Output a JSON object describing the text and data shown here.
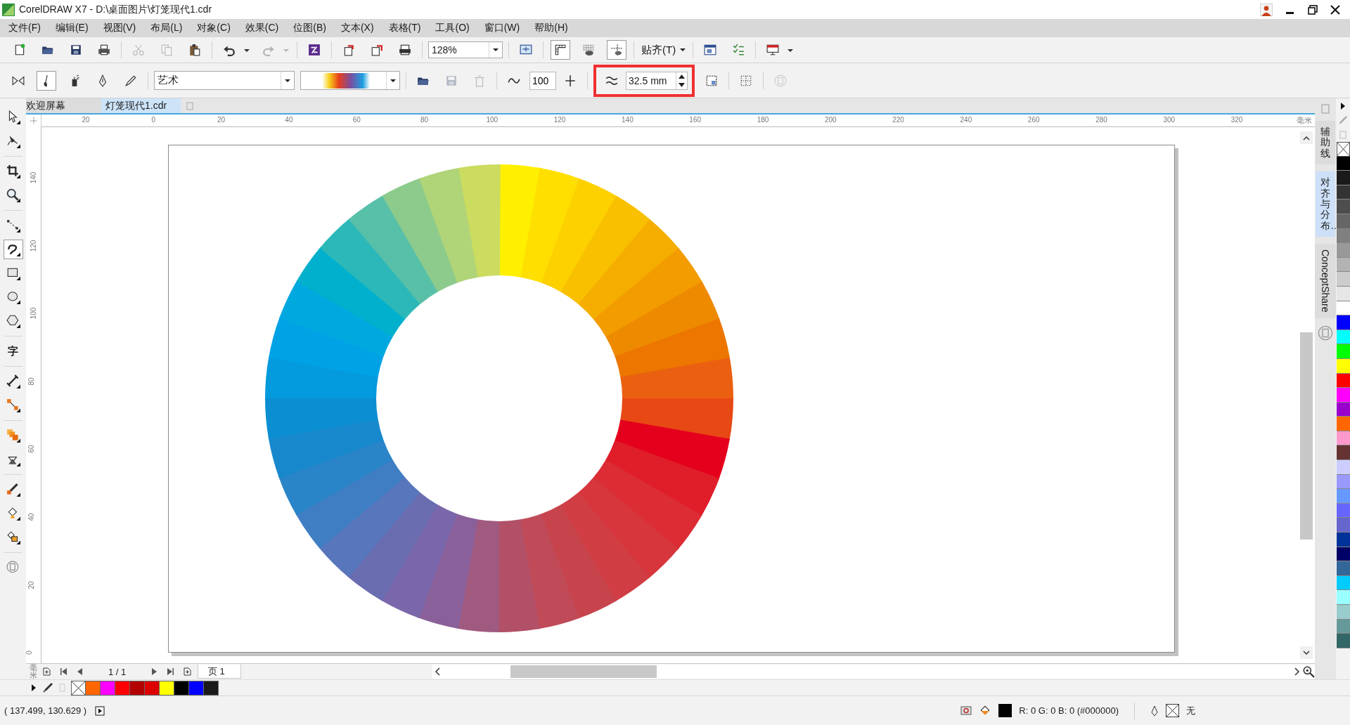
{
  "window": {
    "title": "CorelDRAW X7 - D:\\桌面图片\\灯笼现代1.cdr"
  },
  "menu": [
    "文件(F)",
    "编辑(E)",
    "视图(V)",
    "布局(L)",
    "对象(C)",
    "效果(C)",
    "位图(B)",
    "文本(X)",
    "表格(T)",
    "工具(O)",
    "窗口(W)",
    "帮助(H)"
  ],
  "toolbar": [
    {
      "kind": "new",
      "disabled": false
    },
    {
      "kind": "open",
      "disabled": false
    },
    {
      "kind": "save",
      "disabled": false
    },
    {
      "kind": "print",
      "disabled": false
    },
    {
      "kind": "sep"
    },
    {
      "kind": "cut",
      "disabled": true
    },
    {
      "kind": "copy",
      "disabled": true
    },
    {
      "kind": "paste",
      "disabled": false
    },
    {
      "kind": "sep"
    },
    {
      "kind": "undo",
      "disabled": false
    },
    {
      "kind": "caret",
      "disabled": false
    },
    {
      "kind": "redo",
      "disabled": true
    },
    {
      "kind": "caret",
      "disabled": true
    },
    {
      "kind": "sep"
    },
    {
      "kind": "launcher",
      "disabled": false
    },
    {
      "kind": "sep"
    },
    {
      "kind": "import",
      "disabled": false
    },
    {
      "kind": "export",
      "disabled": false
    },
    {
      "kind": "pdf",
      "disabled": false
    },
    {
      "kind": "sep"
    },
    {
      "kind": "zoom-combo",
      "value": "128%"
    },
    {
      "kind": "sep"
    },
    {
      "kind": "fullscreen",
      "disabled": false
    },
    {
      "kind": "sep"
    },
    {
      "kind": "rulers",
      "disabled": false,
      "selected": true
    },
    {
      "kind": "grid",
      "disabled": false,
      "selected": false
    },
    {
      "kind": "guidelines",
      "disabled": false,
      "selected": true
    },
    {
      "kind": "sep"
    },
    {
      "kind": "menu-button",
      "label": "贴齐(T)"
    },
    {
      "kind": "sep"
    },
    {
      "kind": "options",
      "disabled": false
    },
    {
      "kind": "checklist",
      "disabled": false
    },
    {
      "kind": "sep"
    },
    {
      "kind": "launch",
      "disabled": false
    },
    {
      "kind": "caret",
      "disabled": false
    }
  ],
  "property_bar": [
    {
      "kind": "mirror",
      "disabled": false
    },
    {
      "kind": "brush",
      "disabled": false,
      "selected": true
    },
    {
      "kind": "sprayer",
      "disabled": false,
      "selected": false
    },
    {
      "kind": "calligraphy",
      "disabled": false,
      "selected": false
    },
    {
      "kind": "pressure",
      "disabled": false,
      "selected": false
    },
    {
      "kind": "sep"
    },
    {
      "kind": "style-combo",
      "value": "艺术"
    },
    {
      "kind": "gradient-combo"
    },
    {
      "kind": "sep"
    },
    {
      "kind": "folder",
      "disabled": false
    },
    {
      "kind": "save",
      "disabled": true
    },
    {
      "kind": "delete",
      "disabled": true
    },
    {
      "kind": "sep"
    },
    {
      "kind": "smooth",
      "disabled": false
    },
    {
      "kind": "number-field",
      "value": "100"
    },
    {
      "kind": "plus",
      "disabled": false
    },
    {
      "kind": "sep"
    },
    {
      "kind": "width-group",
      "value": "32.5 mm",
      "highlighted": true
    },
    {
      "kind": "scale",
      "disabled": false
    },
    {
      "kind": "sep"
    },
    {
      "kind": "scatter",
      "disabled": false
    },
    {
      "kind": "sep"
    },
    {
      "kind": "round",
      "disabled": true
    }
  ],
  "toolbox": [
    {
      "kind": "pick",
      "selected": false
    },
    {
      "kind": "shape",
      "selected": false
    },
    {
      "kind": "sep"
    },
    {
      "kind": "crop",
      "selected": false
    },
    {
      "kind": "zoom",
      "selected": false
    },
    {
      "kind": "sep"
    },
    {
      "kind": "freehand",
      "selected": false
    },
    {
      "kind": "artistic",
      "selected": true
    },
    {
      "kind": "rect",
      "selected": false
    },
    {
      "kind": "ellipse",
      "selected": false
    },
    {
      "kind": "polygon",
      "selected": false
    },
    {
      "kind": "sep"
    },
    {
      "kind": "text",
      "label": "字",
      "selected": false
    },
    {
      "kind": "sep"
    },
    {
      "kind": "dimension",
      "selected": false
    },
    {
      "kind": "connector",
      "selected": false
    },
    {
      "kind": "sep"
    },
    {
      "kind": "blend",
      "selected": false
    },
    {
      "kind": "transparency",
      "selected": false
    },
    {
      "kind": "sep"
    },
    {
      "kind": "eyedropper",
      "selected": false
    },
    {
      "kind": "fill",
      "selected": false
    },
    {
      "kind": "smartfill",
      "selected": false
    },
    {
      "kind": "sep"
    },
    {
      "kind": "add",
      "selected": false
    }
  ],
  "tabs": [
    {
      "label": "欢迎屏幕",
      "selected": false
    },
    {
      "label": "灯笼现代1.cdr",
      "selected": true
    }
  ],
  "horizontal_ruler": {
    "labels": [
      "20",
      "0",
      "20",
      "40",
      "60",
      "80",
      "100",
      "120",
      "140",
      "160",
      "180",
      "200",
      "220",
      "240",
      "260",
      "280",
      "300",
      "320"
    ],
    "unit": "毫米"
  },
  "vertical_ruler": {
    "labels": [
      "140",
      "120",
      "100",
      "80",
      "60",
      "40",
      "20",
      "0"
    ],
    "unit": "毫米"
  },
  "page_navigator": {
    "count": "1 / 1",
    "page_tab": "页 1"
  },
  "dockers": [
    {
      "label": "辅助线",
      "selected": false
    },
    {
      "label": "对齐与分布…",
      "selected": true
    },
    {
      "label": "ConceptShare",
      "selected": false
    }
  ],
  "right_palette": [
    {
      "kind": "none"
    },
    {
      "kind": "swatch",
      "color": "#000000"
    },
    {
      "kind": "swatch",
      "color": "#1a1a1a"
    },
    {
      "kind": "swatch",
      "color": "#333333"
    },
    {
      "kind": "swatch",
      "color": "#4d4d4d"
    },
    {
      "kind": "swatch",
      "color": "#666666"
    },
    {
      "kind": "swatch",
      "color": "#808080"
    },
    {
      "kind": "swatch",
      "color": "#999999"
    },
    {
      "kind": "swatch",
      "color": "#b3b3b3"
    },
    {
      "kind": "swatch",
      "color": "#cccccc"
    },
    {
      "kind": "swatch",
      "color": "#e6e6e6"
    },
    {
      "kind": "swatch",
      "color": "#ffffff"
    },
    {
      "kind": "swatch",
      "color": "#0000ff"
    },
    {
      "kind": "swatch",
      "color": "#00ffff"
    },
    {
      "kind": "swatch",
      "color": "#00ff00"
    },
    {
      "kind": "swatch",
      "color": "#ffff00"
    },
    {
      "kind": "swatch",
      "color": "#ff0000"
    },
    {
      "kind": "swatch",
      "color": "#ff00ff"
    },
    {
      "kind": "swatch",
      "color": "#9900cc"
    },
    {
      "kind": "swatch",
      "color": "#ff6600"
    },
    {
      "kind": "swatch",
      "color": "#ff99cc"
    },
    {
      "kind": "swatch",
      "color": "#663333"
    },
    {
      "kind": "swatch",
      "color": "#ccccff"
    },
    {
      "kind": "swatch",
      "color": "#9999ff"
    },
    {
      "kind": "swatch",
      "color": "#6699ff"
    },
    {
      "kind": "swatch",
      "color": "#6666ff"
    },
    {
      "kind": "swatch",
      "color": "#6666cc"
    },
    {
      "kind": "swatch",
      "color": "#003399"
    },
    {
      "kind": "swatch",
      "color": "#000066"
    },
    {
      "kind": "swatch",
      "color": "#336699"
    },
    {
      "kind": "swatch",
      "color": "#00ccff"
    },
    {
      "kind": "swatch",
      "color": "#99ffff"
    },
    {
      "kind": "swatch",
      "color": "#99cccc"
    },
    {
      "kind": "swatch",
      "color": "#669999"
    },
    {
      "kind": "swatch",
      "color": "#336666"
    }
  ],
  "document_palette": [
    {
      "kind": "none"
    },
    {
      "kind": "swatch",
      "color": "#ff6600"
    },
    {
      "kind": "swatch",
      "color": "#ff00ff"
    },
    {
      "kind": "swatch",
      "color": "#ff0000"
    },
    {
      "kind": "swatch",
      "color": "#b30000"
    },
    {
      "kind": "swatch",
      "color": "#dd0000"
    },
    {
      "kind": "swatch",
      "color": "#ffff00"
    },
    {
      "kind": "swatch",
      "color": "#000000"
    },
    {
      "kind": "swatch",
      "color": "#0000ff"
    },
    {
      "kind": "swatch",
      "color": "#1a1a1a"
    }
  ],
  "status_bar": {
    "coordinates": "( 137.499, 130.629 )",
    "fill": {
      "color": "#000000",
      "text": "R: 0 G: 0 B: 0 (#000000)"
    },
    "outline": {
      "text": "无"
    }
  }
}
